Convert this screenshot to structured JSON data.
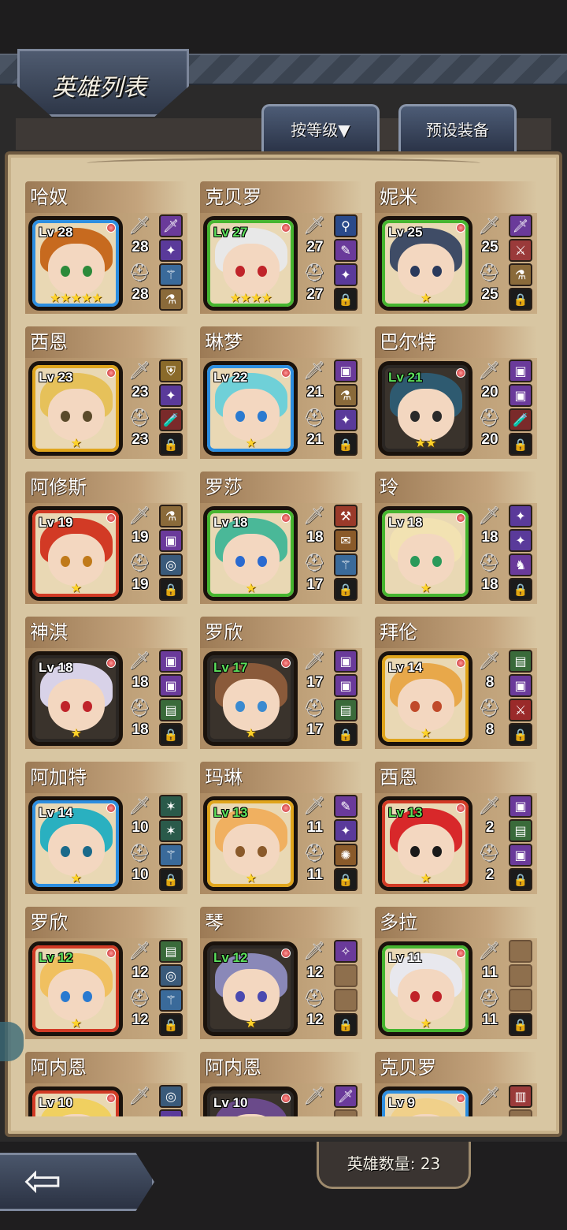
{
  "header": {
    "title": "英雄列表",
    "sort_button": "按等级▼",
    "preset_button": "预设装备"
  },
  "footer": {
    "back_icon": "arrow-left-icon",
    "hero_count_label": "英雄数量: 23"
  },
  "colors": {
    "blue": "#2d8ee0",
    "green": "#46b530",
    "gold": "#e0a51c",
    "red": "#d23a25",
    "dark": "#2a2623",
    "parchment": "#d8c6a2"
  },
  "heroes": [
    {
      "name": "哈奴",
      "level": "Lv 28",
      "lv_green": false,
      "attack": "28",
      "defense": "28",
      "stars": "★★★★★",
      "frame": "blue",
      "hair": "#c76a1f",
      "eye": "#2c8a3a",
      "slots": [
        "sword",
        "wand",
        "staff",
        "potion"
      ]
    },
    {
      "name": "克贝罗",
      "level": "Lv 27",
      "lv_green": true,
      "attack": "27",
      "defense": "27",
      "stars": "★★★★",
      "frame": "green",
      "hair": "#e8e8e8",
      "eye": "#c0242a",
      "slots": [
        "scepter",
        "dagger",
        "wand",
        "lock"
      ]
    },
    {
      "name": "妮米",
      "level": "Lv 25",
      "lv_green": false,
      "attack": "25",
      "defense": "25",
      "stars": "★",
      "frame": "green",
      "hair": "#3f4c66",
      "eye": "#2a3a5c",
      "slots": [
        "sword",
        "spear",
        "potion",
        "lock"
      ]
    },
    {
      "name": "西恩",
      "level": "Lv 23",
      "lv_green": false,
      "attack": "23",
      "defense": "23",
      "stars": "★",
      "frame": "gold",
      "hair": "#e6c15a",
      "eye": "#5a4a2a",
      "slots": [
        "armor",
        "wand",
        "bottle",
        "lock"
      ]
    },
    {
      "name": "琳梦",
      "level": "Lv 22",
      "lv_green": false,
      "attack": "21",
      "defense": "21",
      "stars": "★",
      "frame": "blue",
      "hair": "#6fd0d8",
      "eye": "#2a7ad0",
      "slots": [
        "bag",
        "potion",
        "wand",
        "lock"
      ]
    },
    {
      "name": "巴尔特",
      "level": "Lv 21",
      "lv_green": true,
      "attack": "20",
      "defense": "20",
      "stars": "★★",
      "frame": "dark",
      "hair": "#2e5a70",
      "eye": "#2a2a2a",
      "slots": [
        "bag",
        "bag",
        "bottle",
        "lock"
      ]
    },
    {
      "name": "阿修斯",
      "level": "Lv 19",
      "lv_green": false,
      "attack": "19",
      "defense": "19",
      "stars": "★",
      "frame": "red",
      "hair": "#d23a25",
      "eye": "#c07a1a",
      "slots": [
        "potion",
        "bag",
        "ring",
        "lock"
      ]
    },
    {
      "name": "罗莎",
      "level": "Lv 18",
      "lv_green": false,
      "attack": "18",
      "defense": "17",
      "stars": "★",
      "frame": "green",
      "hair": "#4ab898",
      "eye": "#2a6ad0",
      "slots": [
        "axe",
        "scroll",
        "staff",
        "lock"
      ]
    },
    {
      "name": "玲",
      "level": "Lv 18",
      "lv_green": false,
      "attack": "18",
      "defense": "18",
      "stars": "★",
      "frame": "green",
      "hair": "#f2e2b2",
      "eye": "#2a9a5a",
      "slots": [
        "wand",
        "wand",
        "cloak",
        "lock"
      ]
    },
    {
      "name": "神淇",
      "level": "Lv 18",
      "lv_green": false,
      "attack": "18",
      "defense": "18",
      "stars": "★",
      "frame": "dark",
      "hair": "#d8d2e8",
      "eye": "#c0242a",
      "slots": [
        "bag",
        "bag",
        "pack",
        "lock"
      ]
    },
    {
      "name": "罗欣",
      "level": "Lv 17",
      "lv_green": true,
      "attack": "17",
      "defense": "17",
      "stars": "★",
      "frame": "dark",
      "hair": "#8a5a3a",
      "eye": "#3a8ad0",
      "slots": [
        "bag",
        "bag",
        "pack",
        "lock"
      ]
    },
    {
      "name": "拜伦",
      "level": "Lv 14",
      "lv_green": false,
      "attack": "8",
      "defense": "8",
      "stars": "★",
      "frame": "gold",
      "hair": "#e8a84a",
      "eye": "#c04a2a",
      "slots": [
        "pack",
        "bag",
        "blade",
        "lock"
      ]
    },
    {
      "name": "阿加特",
      "level": "Lv 14",
      "lv_green": false,
      "attack": "10",
      "defense": "10",
      "stars": "★",
      "frame": "blue",
      "hair": "#2ab0c0",
      "eye": "#1a6a8a",
      "slots": [
        "claw",
        "claw",
        "staff",
        "lock"
      ]
    },
    {
      "name": "玛琳",
      "level": "Lv 13",
      "lv_green": true,
      "attack": "11",
      "defense": "11",
      "stars": "★",
      "frame": "gold",
      "hair": "#f0b060",
      "eye": "#8a5a2a",
      "slots": [
        "dagger",
        "wand",
        "orb",
        "lock"
      ]
    },
    {
      "name": "西恩",
      "level": "Lv 13",
      "lv_green": true,
      "attack": "2",
      "defense": "2",
      "stars": "★",
      "frame": "red",
      "hair": "#d8282a",
      "eye": "#1a1a1a",
      "slots": [
        "bag",
        "pack",
        "bag",
        "lock"
      ]
    },
    {
      "name": "罗欣",
      "level": "Lv 12",
      "lv_green": true,
      "attack": "12",
      "defense": "12",
      "stars": "★",
      "frame": "red",
      "hair": "#f0c060",
      "eye": "#2a7ad0",
      "slots": [
        "pack",
        "ring",
        "staff",
        "lock"
      ]
    },
    {
      "name": "琴",
      "level": "Lv 12",
      "lv_green": true,
      "attack": "12",
      "defense": "12",
      "stars": "★",
      "frame": "dark",
      "hair": "#8a88b8",
      "eye": "#4a4ab0",
      "slots": [
        "rune",
        "empty",
        "empty",
        "lock"
      ]
    },
    {
      "name": "多拉",
      "level": "Lv 11",
      "lv_green": false,
      "attack": "11",
      "defense": "11",
      "stars": "★",
      "frame": "green",
      "hair": "#e8e8ee",
      "eye": "#c0242a",
      "slots": [
        "empty",
        "empty",
        "empty",
        "lock"
      ]
    },
    {
      "name": "阿内恩",
      "level": "Lv 10",
      "lv_green": false,
      "attack": "",
      "defense": "",
      "stars": "",
      "frame": "red",
      "hair": "#f0d060",
      "eye": "#2a6a3a",
      "slots": [
        "ring",
        "wand",
        "empty",
        "lock"
      ]
    },
    {
      "name": "阿内恩",
      "level": "Lv 10",
      "lv_green": false,
      "attack": "",
      "defense": "",
      "stars": "",
      "frame": "dark",
      "hair": "#6a4a8a",
      "eye": "#2a2a6a",
      "slots": [
        "sword",
        "empty",
        "empty",
        "lock"
      ]
    },
    {
      "name": "克贝罗",
      "level": "Lv 9",
      "lv_green": false,
      "attack": "",
      "defense": "",
      "stars": "",
      "frame": "blue",
      "hair": "#f0d08a",
      "eye": "#2a2a2a",
      "slots": [
        "chest",
        "empty",
        "empty",
        "lock"
      ]
    }
  ]
}
